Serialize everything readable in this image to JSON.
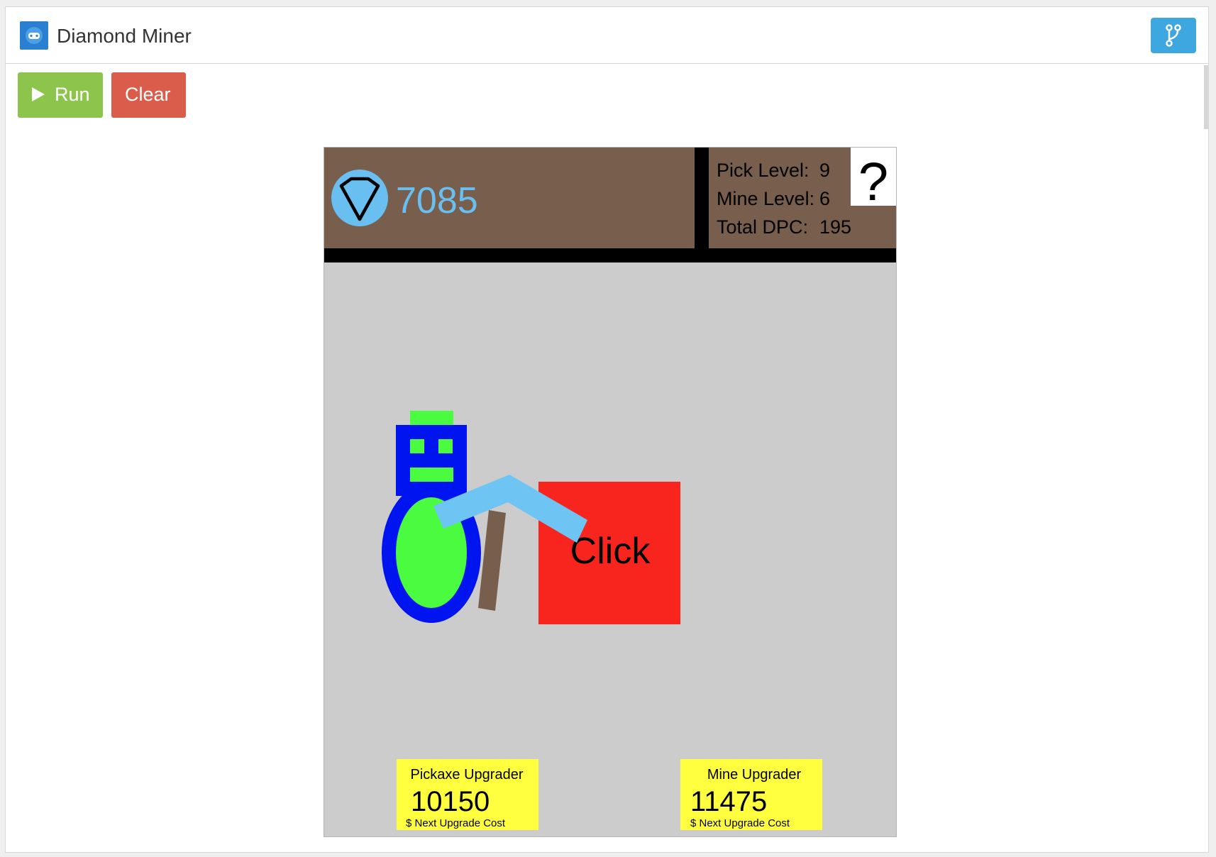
{
  "app": {
    "title": "Diamond Miner",
    "icon": "gamepad-icon",
    "accent_color": "#2a7fd0"
  },
  "toolbar": {
    "run_label": "Run",
    "run_icon": "play-icon",
    "run_color": "#8dc44c",
    "clear_label": "Clear",
    "clear_color": "#d95d4a",
    "fork_icon": "fork-icon",
    "fork_color": "#3fa7df"
  },
  "game": {
    "diamonds": "7085",
    "diamond_icon": "diamond-icon",
    "stats": {
      "pick_level_label": "Pick Level:",
      "pick_level_value": "9",
      "mine_level_label": "Mine Level:",
      "mine_level_value": "6",
      "total_dpc_label": "Total DPC:",
      "total_dpc_value": "195"
    },
    "help_label": "?",
    "click_label": "Click",
    "pickaxe_upgrader": {
      "title": "Pickaxe Upgrader",
      "cost": "10150",
      "caption": "$ Next Upgrade Cost"
    },
    "mine_upgrader": {
      "title": "Mine Upgrader",
      "cost": "11475",
      "caption": "$ Next Upgrade Cost"
    },
    "colors": {
      "hud": "#785e4c",
      "field": "#cccccc",
      "diamond": "#69bff0",
      "block": "#f8251f",
      "robot_body": "#0014ef",
      "robot_accent": "#4bfb40",
      "pickaxe_head": "#6ec5f4",
      "pickaxe_handle": "#785e4c",
      "upgrader": "#ffff40"
    }
  }
}
